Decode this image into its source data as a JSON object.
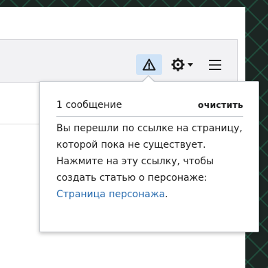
{
  "toolbar": {
    "alert_icon": "warning-triangle-icon",
    "settings_icon": "gear-icon",
    "settings_dropdown_icon": "caret-down-icon",
    "menu_icon": "hamburger-menu-icon"
  },
  "notifications": {
    "count_text": "1 сообщение",
    "clear_label": "очистить",
    "message_line1": "Вы перешли по ссылке на страницу, которой пока не существует.",
    "message_line2": "Нажмите на эту ссылку, чтобы создать статью о персонаже:",
    "link_text": "Страница персонажа",
    "link_suffix": "."
  },
  "colors": {
    "accent": "#2a6db0",
    "alert_button_bg": "#cfe3f7",
    "background_pattern": "#1c2623"
  }
}
